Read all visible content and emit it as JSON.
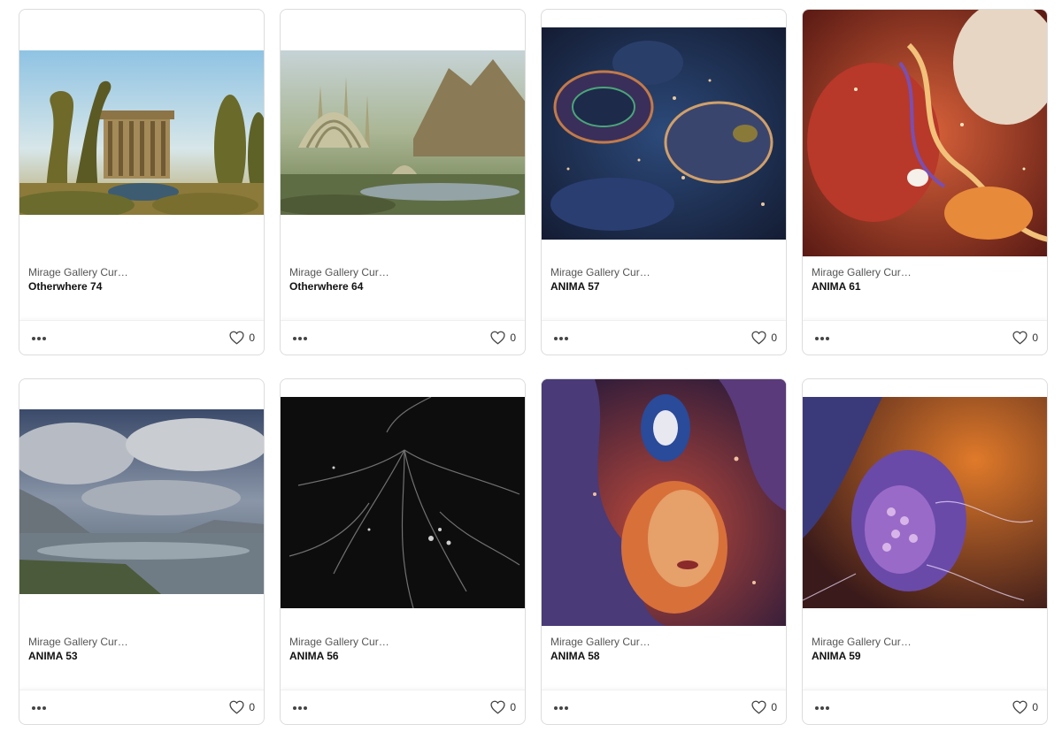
{
  "cards": [
    {
      "creator": "Mirage Gallery Cura…",
      "title": "Otherwhere 74",
      "likes": "0",
      "icon": "heart-icon",
      "menu_icon": "more-options-icon"
    },
    {
      "creator": "Mirage Gallery Cura…",
      "title": "Otherwhere 64",
      "likes": "0",
      "icon": "heart-icon",
      "menu_icon": "more-options-icon"
    },
    {
      "creator": "Mirage Gallery Cura…",
      "title": "ANIMA 57",
      "likes": "0",
      "icon": "heart-icon",
      "menu_icon": "more-options-icon"
    },
    {
      "creator": "Mirage Gallery Cura…",
      "title": "ANIMA 61",
      "likes": "0",
      "icon": "heart-icon",
      "menu_icon": "more-options-icon"
    },
    {
      "creator": "Mirage Gallery Cura…",
      "title": "ANIMA 53",
      "likes": "0",
      "icon": "heart-icon",
      "menu_icon": "more-options-icon"
    },
    {
      "creator": "Mirage Gallery Cura…",
      "title": "ANIMA 56",
      "likes": "0",
      "icon": "heart-icon",
      "menu_icon": "more-options-icon"
    },
    {
      "creator": "Mirage Gallery Cura…",
      "title": "ANIMA 58",
      "likes": "0",
      "icon": "heart-icon",
      "menu_icon": "more-options-icon"
    },
    {
      "creator": "Mirage Gallery Cura…",
      "title": "ANIMA 59",
      "likes": "0",
      "icon": "heart-icon",
      "menu_icon": "more-options-icon"
    }
  ]
}
